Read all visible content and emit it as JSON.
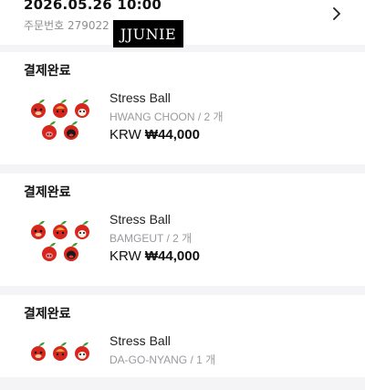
{
  "header": {
    "order_date": "2026.05.26 10:00",
    "order_number_label": "주문번호",
    "order_number": "279022",
    "watermark": "JJUNIE"
  },
  "orders": [
    {
      "status": "결제완료",
      "product_name": "Stress Ball",
      "option": "HWANG CHOON / 2 개",
      "currency": "KRW",
      "price": "₩44,000",
      "thumbnail": "apple-character-stress-balls"
    },
    {
      "status": "결제완료",
      "product_name": "Stress Ball",
      "option": "BAMGEUT / 2 개",
      "currency": "KRW",
      "price": "₩44,000",
      "thumbnail": "apple-character-stress-balls"
    },
    {
      "status": "결제완료",
      "product_name": "Stress Ball",
      "option": "DA-GO-NYANG / 1 개",
      "currency": "",
      "price": "",
      "thumbnail": "apple-character-stress-balls"
    }
  ],
  "colors": {
    "background": "#f4f4f6",
    "card": "#ffffff",
    "apple_red": "#d7261e",
    "leaf_green": "#3d9a2e",
    "muted_text": "#9a9aa0"
  },
  "icons": {
    "header_action": "chevron-right-icon"
  }
}
